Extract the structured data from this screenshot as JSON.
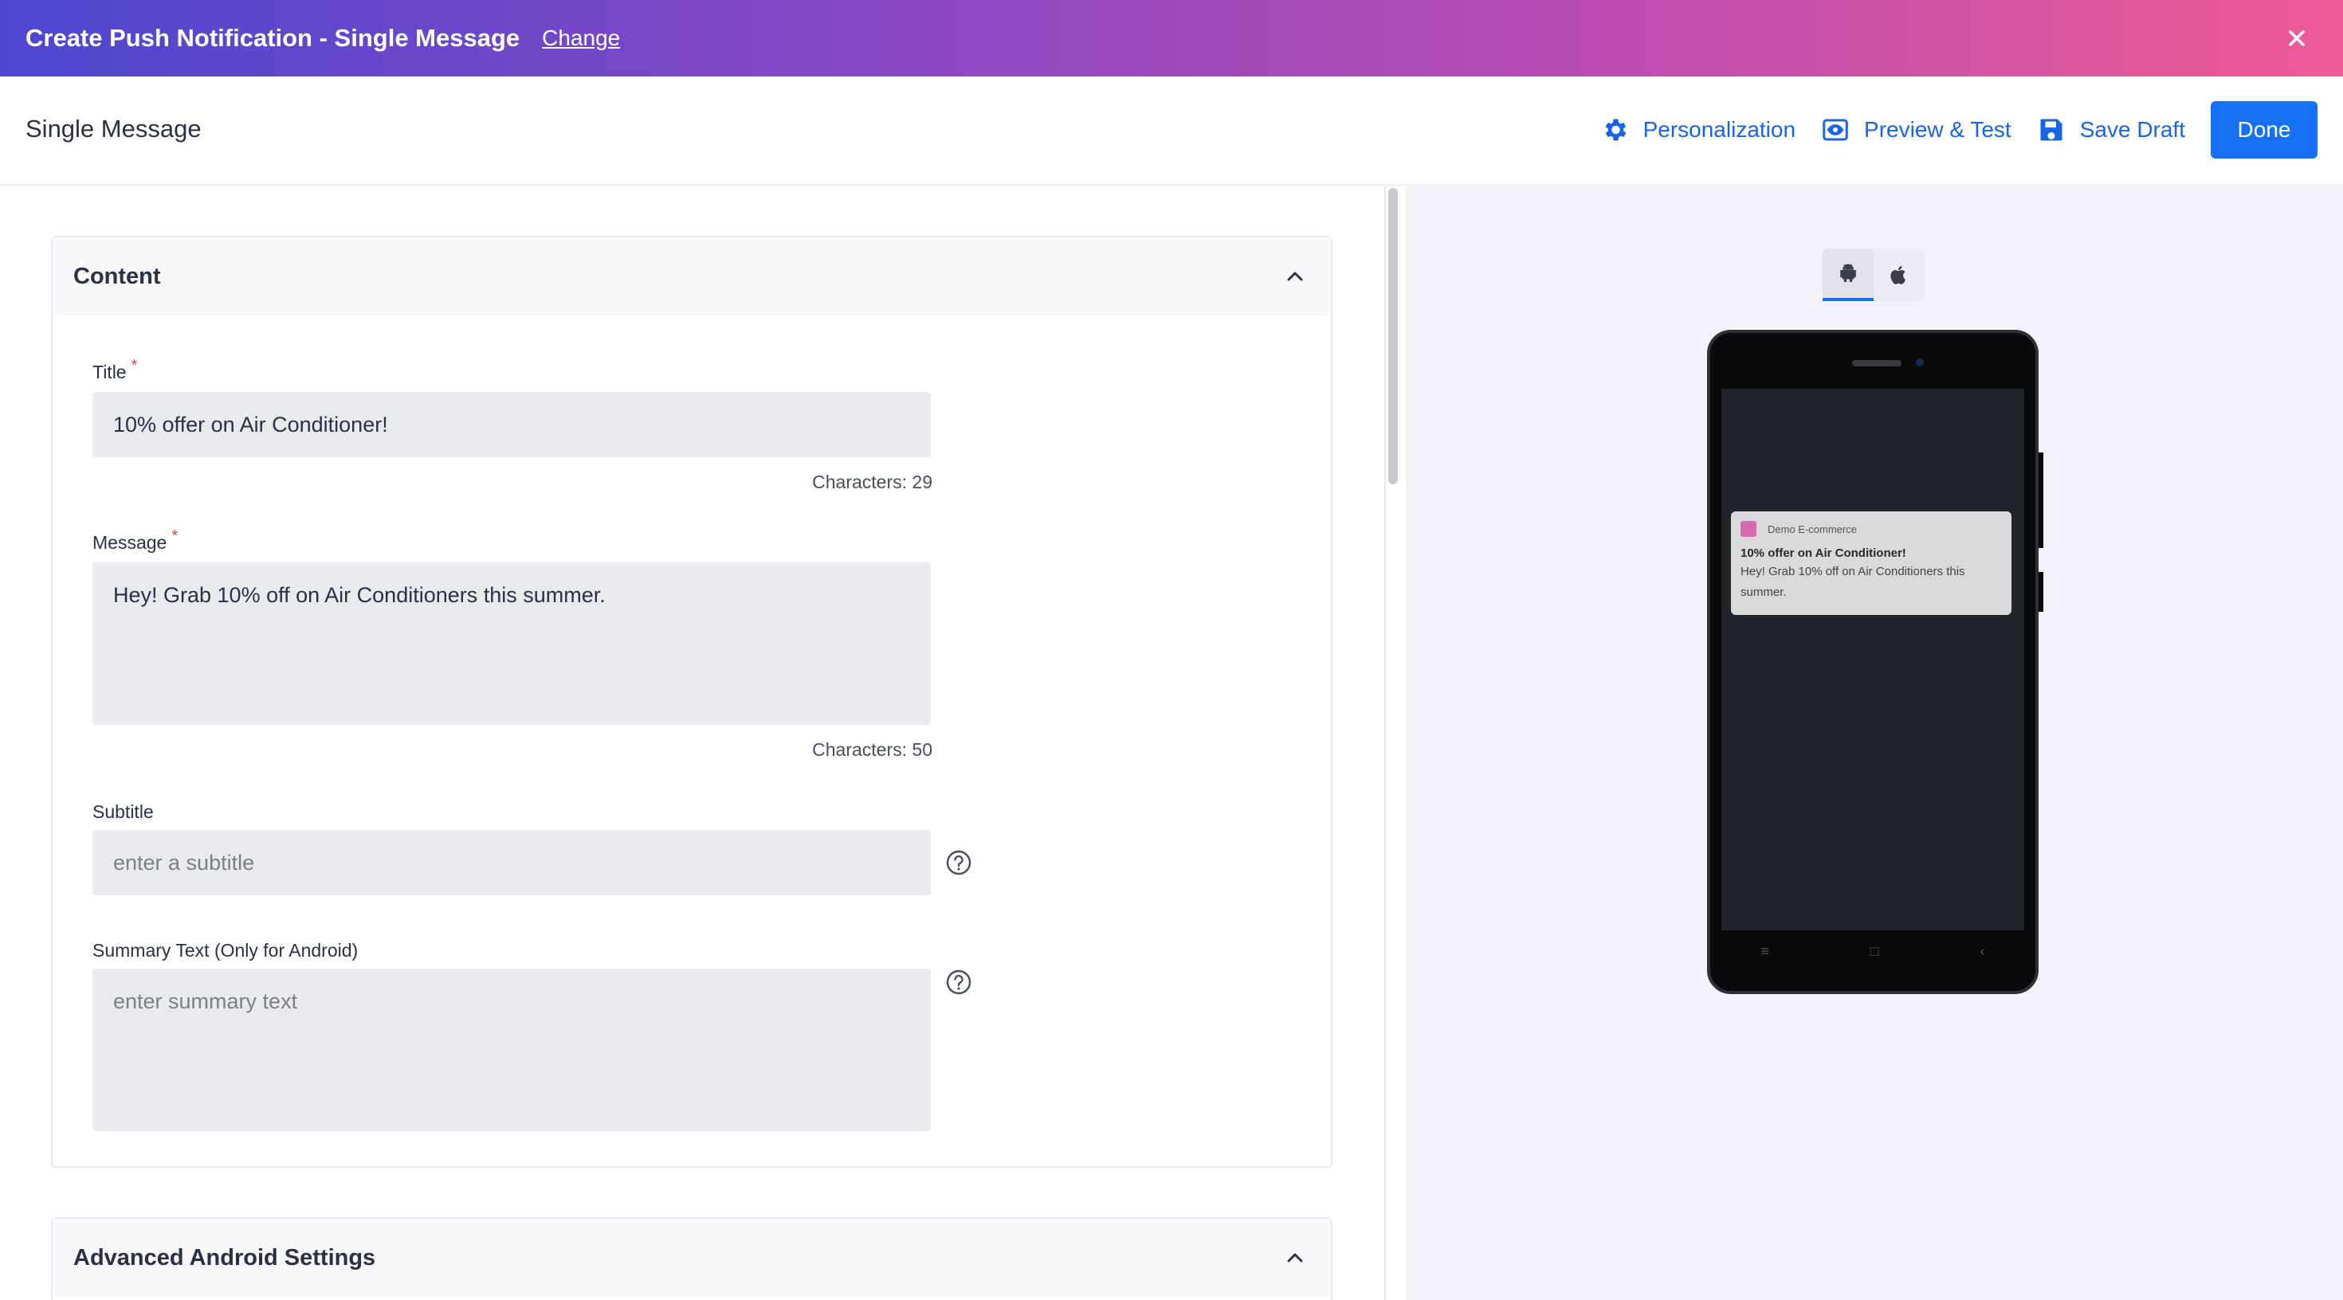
{
  "topbar": {
    "title": "Create Push Notification - Single Message",
    "change_label": "Change"
  },
  "header": {
    "page_title": "Single Message",
    "personalization_label": "Personalization",
    "preview_label": "Preview & Test",
    "save_draft_label": "Save Draft",
    "done_label": "Done"
  },
  "content_card": {
    "heading": "Content",
    "title_label": "Title",
    "title_value": "10% offer on Air Conditioner!",
    "title_count": "Characters: 29",
    "message_label": "Message",
    "message_value": "Hey! Grab 10% off on Air Conditioners this summer.",
    "message_count": "Characters: 50",
    "subtitle_label": "Subtitle",
    "subtitle_placeholder": "enter a subtitle",
    "summary_label": "Summary Text (Only for Android)",
    "summary_placeholder": "enter summary text",
    "required_mark": "*"
  },
  "advanced_card": {
    "heading": "Advanced Android Settings"
  },
  "preview": {
    "platforms": [
      "android-icon",
      "apple-icon"
    ],
    "active_platform": "android",
    "notification": {
      "app_name": "Demo E-commerce",
      "title": "10% offer on Air Conditioner!",
      "body": "Hey! Grab 10% off on Air Conditioners this summer."
    },
    "nav_keys": [
      "≡",
      "□",
      "‹"
    ]
  },
  "colors": {
    "primary": "#1670f3",
    "link": "#1864e6",
    "gradient_start": "#4d47cf",
    "gradient_end": "#ef5b96",
    "required": "#e6414a",
    "app_icon": "#d86ab0"
  }
}
